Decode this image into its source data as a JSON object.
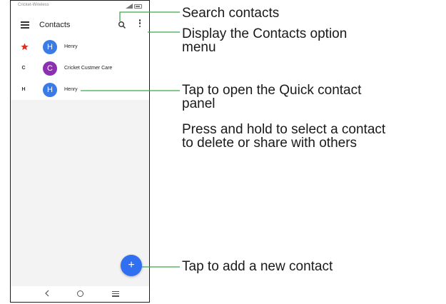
{
  "status_bar": {
    "carrier": "Cricket-Wireless"
  },
  "app_bar": {
    "title": "Contacts"
  },
  "contacts": [
    {
      "index": "★",
      "initial": "H",
      "name": "Henry",
      "avatar_color": "#3b7be8",
      "starred": true
    },
    {
      "index": "C",
      "initial": "C",
      "name": "Cricket Custmer Care",
      "avatar_color": "#8d2fb1",
      "starred": false
    },
    {
      "index": "H",
      "initial": "H",
      "name": "Henry",
      "avatar_color": "#3b7be8",
      "starred": false
    }
  ],
  "fab": {
    "label": "+",
    "color": "#2f6ff0"
  },
  "callouts": {
    "search": "Search contacts",
    "options": "Display the Contacts option\nmenu",
    "quick_contact": "Tap to open the Quick contact\npanel",
    "press_hold": "Press and hold to select a contact\nto delete or share with others",
    "add_contact": "Tap to add a new contact"
  },
  "colors": {
    "callout_line": "#3aa94a",
    "star": "#d93025"
  },
  "icons": [
    "menu-icon",
    "search-icon",
    "more-vert-icon",
    "star-icon",
    "add-icon",
    "back-icon",
    "home-icon",
    "recents-icon",
    "signal-icon",
    "battery-icon"
  ]
}
